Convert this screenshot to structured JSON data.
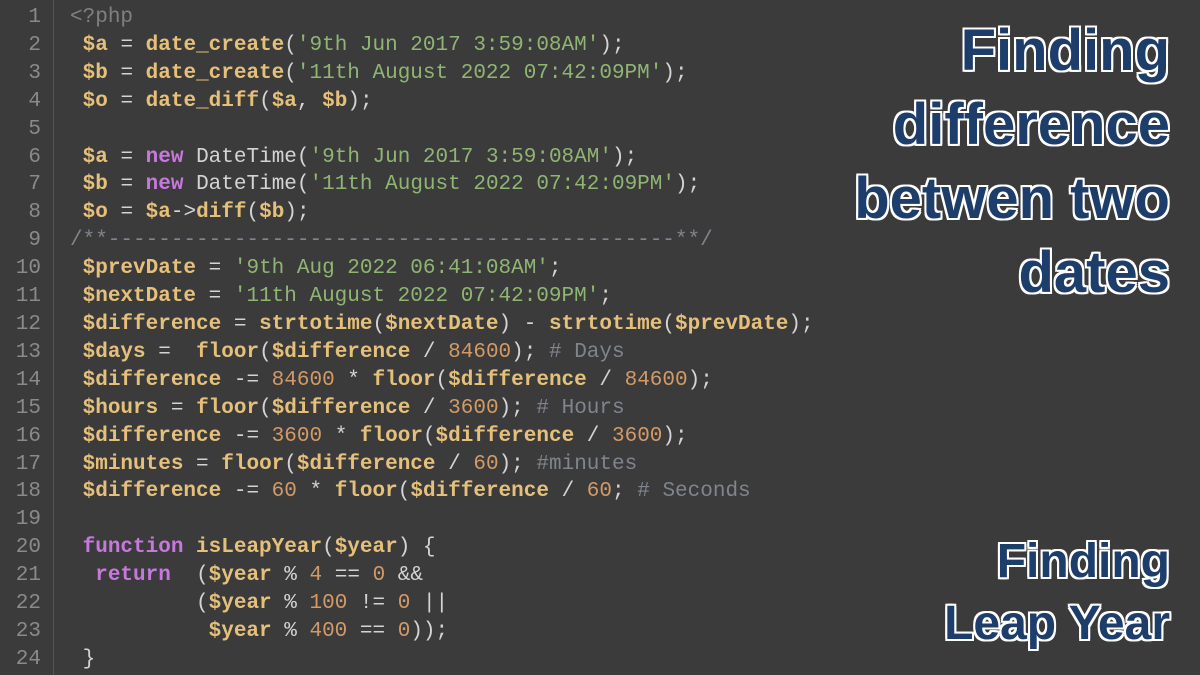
{
  "gutter": [
    "1",
    "2",
    "3",
    "4",
    "5",
    "6",
    "7",
    "8",
    "9",
    "10",
    "11",
    "12",
    "13",
    "14",
    "15",
    "16",
    "17",
    "18",
    "19",
    "20",
    "21",
    "22",
    "23",
    "24"
  ],
  "code": {
    "l1": {
      "tag_open": "<?",
      "tag_name": "php"
    },
    "l2": {
      "var": "$a",
      "fn": "date_create",
      "str": "'9th Jun 2017 3:59:08AM'"
    },
    "l3": {
      "var": "$b",
      "fn": "date_create",
      "str": "'11th August 2022 07:42:09PM'"
    },
    "l4": {
      "var": "$o",
      "fn": "date_diff",
      "a": "$a",
      "b": "$b"
    },
    "l6": {
      "var": "$a",
      "kw": "new",
      "cls": "DateTime",
      "str": "'9th Jun 2017 3:59:08AM'"
    },
    "l7": {
      "var": "$b",
      "kw": "new",
      "cls": "DateTime",
      "str": "'11th August 2022 07:42:09PM'"
    },
    "l8": {
      "var": "$o",
      "a": "$a",
      "fn": "diff",
      "b": "$b"
    },
    "l9": {
      "cmt": "/**---------------------------------------------**/"
    },
    "l10": {
      "var": "$prevDate",
      "str": "'9th Aug 2022 06:41:08AM'"
    },
    "l11": {
      "var": "$nextDate",
      "str": "'11th August 2022 07:42:09PM'"
    },
    "l12": {
      "var": "$difference",
      "fn": "strtotime",
      "a": "$nextDate",
      "b": "$prevDate"
    },
    "l13": {
      "var": "$days",
      "fn": "floor",
      "a": "$difference",
      "num": "84600",
      "cmt": "# Days"
    },
    "l14": {
      "var": "$difference",
      "num": "84600",
      "fn": "floor",
      "a": "$difference",
      "num2": "84600"
    },
    "l15": {
      "var": "$hours",
      "fn": "floor",
      "a": "$difference",
      "num": "3600",
      "cmt": "# Hours"
    },
    "l16": {
      "var": "$difference",
      "num": "3600",
      "fn": "floor",
      "a": "$difference",
      "num2": "3600"
    },
    "l17": {
      "var": "$minutes",
      "fn": "floor",
      "a": "$difference",
      "num": "60",
      "cmt": "#minutes"
    },
    "l18": {
      "var": "$difference",
      "num": "60",
      "fn": "floor",
      "a": "$difference",
      "num2": "60",
      "cmt": "# Seconds"
    },
    "l20": {
      "kw": "function",
      "fn": "isLeapYear",
      "a": "$year"
    },
    "l21": {
      "kw": "return",
      "a": "$year",
      "num": "4",
      "num2": "0"
    },
    "l22": {
      "a": "$year",
      "num": "100",
      "num2": "0"
    },
    "l23": {
      "a": "$year",
      "num": "400",
      "num2": "0"
    }
  },
  "overlay1": {
    "l1": "Finding",
    "l2": "difference",
    "l3": "betwen two",
    "l4": "dates"
  },
  "overlay2": {
    "l1": "Finding",
    "l2": "Leap Year"
  }
}
